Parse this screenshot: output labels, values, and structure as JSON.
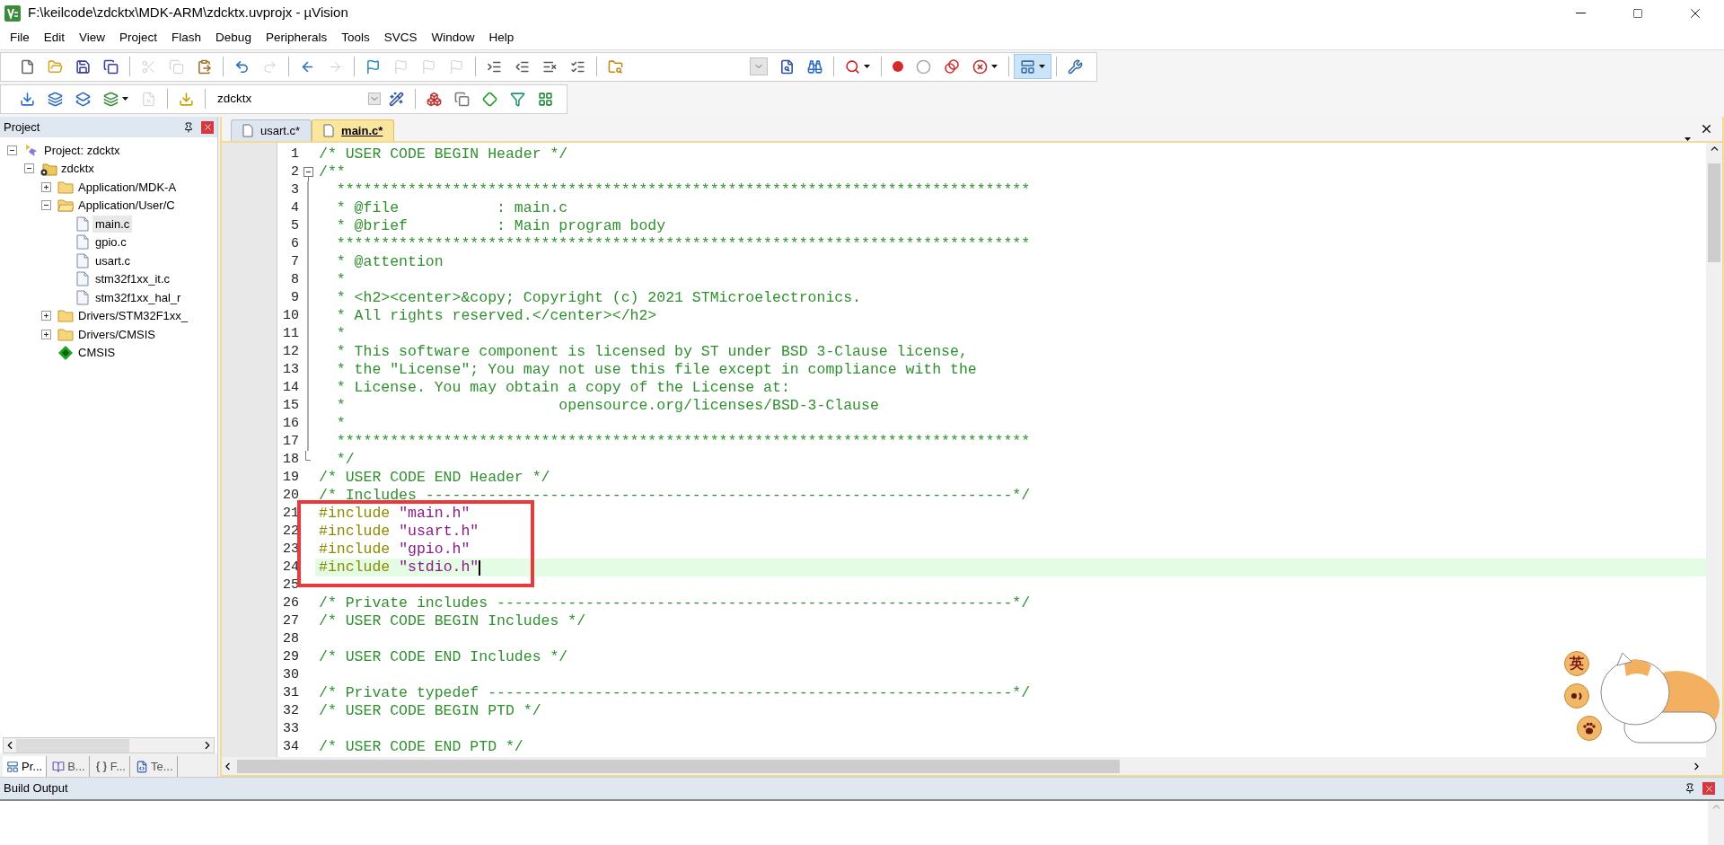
{
  "window": {
    "title": "F:\\keilcode\\zdcktx\\MDK-ARM\\zdcktx.uvprojx - µVision"
  },
  "menu": [
    "File",
    "Edit",
    "View",
    "Project",
    "Flash",
    "Debug",
    "Peripherals",
    "Tools",
    "SVCS",
    "Window",
    "Help"
  ],
  "toolbar_1": {
    "left": [
      [
        {
          "kind": "blank-page",
          "disabled": false
        },
        {
          "kind": "open-folder",
          "disabled": false
        },
        {
          "kind": "floppy-disk",
          "disabled": false
        },
        {
          "kind": "floppy-disks",
          "disabled": false
        }
      ],
      [
        {
          "kind": "scissors",
          "disabled": true
        },
        {
          "kind": "copy-pages",
          "disabled": true
        },
        {
          "kind": "clipboard",
          "disabled": false
        }
      ],
      [
        {
          "kind": "undo-arrow",
          "disabled": false
        },
        {
          "kind": "redo-arrow",
          "disabled": true
        }
      ],
      [
        {
          "kind": "left-arrow",
          "disabled": false
        },
        {
          "kind": "right-arrow",
          "disabled": true
        }
      ],
      [
        {
          "kind": "flag",
          "disabled": false
        },
        {
          "kind": "flag-up",
          "disabled": true
        },
        {
          "kind": "flag-down",
          "disabled": true
        },
        {
          "kind": "flag-x",
          "disabled": true
        }
      ],
      [
        {
          "kind": "indent",
          "disabled": false
        },
        {
          "kind": "outdent",
          "disabled": false
        },
        {
          "kind": "comment-lines",
          "disabled": false
        },
        {
          "kind": "uncomment-lines",
          "disabled": false
        }
      ],
      [
        {
          "kind": "folder-binoculars",
          "disabled": false
        }
      ]
    ],
    "right": [
      [
        {
          "kind": "dropdown",
          "disabled": false
        },
        {
          "kind": "page-search",
          "disabled": false
        },
        {
          "kind": "binoculars",
          "disabled": false
        }
      ],
      [
        {
          "kind": "magnifier",
          "disabled": false,
          "menu": true
        }
      ],
      [
        {
          "kind": "dot",
          "disabled": false
        },
        {
          "kind": "empty-circle",
          "disabled": false
        },
        {
          "kind": "two-circles",
          "disabled": false
        },
        {
          "kind": "dot-x",
          "disabled": false,
          "menu": true
        }
      ],
      [
        {
          "kind": "window-layout",
          "disabled": false,
          "menu": true,
          "pressed": true
        }
      ],
      [
        {
          "kind": "wrench",
          "disabled": false
        }
      ]
    ]
  },
  "toolbar_2": {
    "left": [
      [
        {
          "kind": "stack-down",
          "disabled": false
        },
        {
          "kind": "tray-down",
          "disabled": false
        },
        {
          "kind": "tray-double",
          "disabled": false
        },
        {
          "kind": "stack-check",
          "disabled": false,
          "menu": true
        },
        {
          "kind": "tray-x",
          "disabled": true
        }
      ],
      [
        {
          "kind": "load-arrows",
          "disabled": false
        }
      ]
    ],
    "target": "zdcktx",
    "right": [
      [
        {
          "kind": "magic-wand",
          "disabled": false
        }
      ],
      [
        {
          "kind": "colored-blocks",
          "disabled": false
        },
        {
          "kind": "stacked-windows",
          "disabled": false
        },
        {
          "kind": "diamond",
          "disabled": false
        },
        {
          "kind": "funnel",
          "disabled": false
        },
        {
          "kind": "grid-tiles",
          "disabled": false
        }
      ]
    ]
  },
  "project_panel": {
    "title": "Project",
    "tree": [
      {
        "label": "Project: zdcktx",
        "kind": "project",
        "expanded": true,
        "children": [
          {
            "label": "zdcktx",
            "kind": "target",
            "expanded": true,
            "children": [
              {
                "label": "Application/MDK-A",
                "kind": "group",
                "expanded": false
              },
              {
                "label": "Application/User/C",
                "kind": "group",
                "expanded": true,
                "children": [
                  {
                    "label": "main.c",
                    "kind": "file",
                    "selected": true
                  },
                  {
                    "label": "gpio.c",
                    "kind": "file",
                    "selected": false
                  },
                  {
                    "label": "usart.c",
                    "kind": "file",
                    "selected": false
                  },
                  {
                    "label": "stm32f1xx_it.c",
                    "kind": "file",
                    "selected": false
                  },
                  {
                    "label": "stm32f1xx_hal_r",
                    "kind": "file",
                    "selected": false
                  }
                ]
              },
              {
                "label": "Drivers/STM32F1xx_",
                "kind": "group",
                "expanded": false
              },
              {
                "label": "Drivers/CMSIS",
                "kind": "group",
                "expanded": false
              },
              {
                "label": "CMSIS",
                "kind": "component"
              }
            ]
          }
        ]
      }
    ],
    "tabs": [
      {
        "label": "Pr...",
        "kind": "project",
        "selected": true
      },
      {
        "label": "B...",
        "kind": "books",
        "selected": false
      },
      {
        "label": "F...",
        "kind": "functions",
        "selected": false
      },
      {
        "label": "Te...",
        "kind": "templates",
        "selected": false
      }
    ]
  },
  "editor": {
    "tabs": [
      {
        "label": "usart.c*",
        "selected": false
      },
      {
        "label": "main.c*",
        "selected": true
      }
    ],
    "lines": [
      {
        "number": "1",
        "kind": "comment",
        "text": "/* USER CODE BEGIN Header */",
        "current": false
      },
      {
        "number": "2",
        "kind": "comment",
        "text": "/**",
        "current": false,
        "fold_open": true
      },
      {
        "number": "3",
        "kind": "comment",
        "text": "  ******************************************************************************",
        "current": false,
        "in_fold": true
      },
      {
        "number": "4",
        "kind": "comment",
        "text": "  * @file           : main.c",
        "current": false,
        "in_fold": true
      },
      {
        "number": "5",
        "kind": "comment",
        "text": "  * @brief          : Main program body",
        "current": false,
        "in_fold": true
      },
      {
        "number": "6",
        "kind": "comment",
        "text": "  ******************************************************************************",
        "current": false,
        "in_fold": true
      },
      {
        "number": "7",
        "kind": "comment",
        "text": "  * @attention",
        "current": false,
        "in_fold": true
      },
      {
        "number": "8",
        "kind": "comment",
        "text": "  *",
        "current": false,
        "in_fold": true
      },
      {
        "number": "9",
        "kind": "comment",
        "text": "  * <h2><center>&copy; Copyright (c) 2021 STMicroelectronics.",
        "current": false,
        "in_fold": true
      },
      {
        "number": "10",
        "kind": "comment",
        "text": "  * All rights reserved.</center></h2>",
        "current": false,
        "in_fold": true
      },
      {
        "number": "11",
        "kind": "comment",
        "text": "  *",
        "current": false,
        "in_fold": true
      },
      {
        "number": "12",
        "kind": "comment",
        "text": "  * This software component is licensed by ST under BSD 3-Clause license,",
        "current": false,
        "in_fold": true
      },
      {
        "number": "13",
        "kind": "comment",
        "text": "  * the \"License\"; You may not use this file except in compliance with the",
        "current": false,
        "in_fold": true
      },
      {
        "number": "14",
        "kind": "comment",
        "text": "  * License. You may obtain a copy of the License at:",
        "current": false,
        "in_fold": true
      },
      {
        "number": "15",
        "kind": "comment",
        "text": "  *                        opensource.org/licenses/BSD-3-Clause",
        "current": false,
        "in_fold": true
      },
      {
        "number": "16",
        "kind": "comment",
        "text": "  *",
        "current": false,
        "in_fold": true
      },
      {
        "number": "17",
        "kind": "comment",
        "text": "  ******************************************************************************",
        "current": false,
        "in_fold": true
      },
      {
        "number": "18",
        "kind": "comment",
        "text": "  */",
        "current": false,
        "fold_end": true
      },
      {
        "number": "19",
        "kind": "comment",
        "text": "/* USER CODE END Header */",
        "current": false
      },
      {
        "number": "20",
        "kind": "comment",
        "text": "/* Includes ------------------------------------------------------------------*/",
        "current": false
      },
      {
        "number": "21",
        "kind": "include",
        "directive": "#include",
        "path": "\"main.h\"",
        "current": false
      },
      {
        "number": "22",
        "kind": "include",
        "directive": "#include",
        "path": "\"usart.h\"",
        "current": false
      },
      {
        "number": "23",
        "kind": "include",
        "directive": "#include",
        "path": "\"gpio.h\"",
        "current": false
      },
      {
        "number": "24",
        "kind": "include",
        "directive": "#include",
        "path": "\"stdio.h\"",
        "current": true
      },
      {
        "number": "25",
        "kind": "blank",
        "current": false
      },
      {
        "number": "26",
        "kind": "comment",
        "text": "/* Private includes ----------------------------------------------------------*/",
        "current": false
      },
      {
        "number": "27",
        "kind": "comment",
        "text": "/* USER CODE BEGIN Includes */",
        "current": false
      },
      {
        "number": "28",
        "kind": "blank",
        "current": false
      },
      {
        "number": "29",
        "kind": "comment",
        "text": "/* USER CODE END Includes */",
        "current": false
      },
      {
        "number": "30",
        "kind": "blank",
        "current": false
      },
      {
        "number": "31",
        "kind": "comment",
        "text": "/* Private typedef -----------------------------------------------------------*/",
        "current": false
      },
      {
        "number": "32",
        "kind": "comment",
        "text": "/* USER CODE BEGIN PTD */",
        "current": false
      },
      {
        "number": "33",
        "kind": "blank",
        "current": false
      },
      {
        "number": "34",
        "kind": "comment",
        "text": "/* USER CODE END PTD */",
        "current": false
      }
    ]
  },
  "ime_widget": {
    "language": "英"
  },
  "build_output": {
    "title": "Build Output"
  }
}
